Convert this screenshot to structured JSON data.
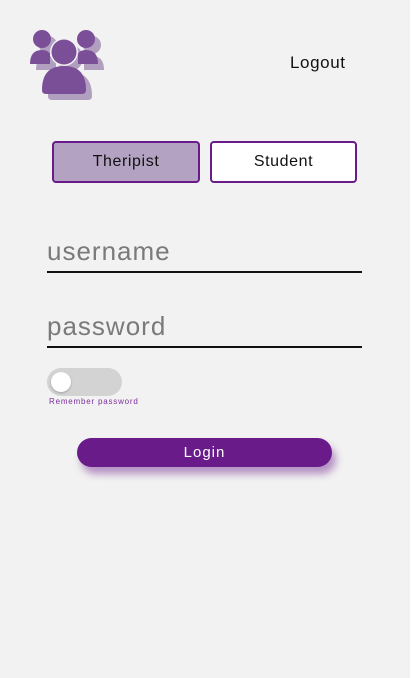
{
  "header": {
    "logo_icon": "users-group-icon",
    "logout_label": "Logout"
  },
  "role_selector": {
    "therapist_label": "Theripist",
    "student_label": "Student",
    "selected": "Theripist"
  },
  "form": {
    "username_placeholder": "username",
    "username_value": "",
    "password_placeholder": "password",
    "password_value": "",
    "remember_label": "Remember password",
    "remember_checked": false,
    "login_label": "Login"
  },
  "colors": {
    "accent": "#6a1b8a",
    "selected_role_bg": "#b3a2c1",
    "background": "#f2f2f2"
  }
}
